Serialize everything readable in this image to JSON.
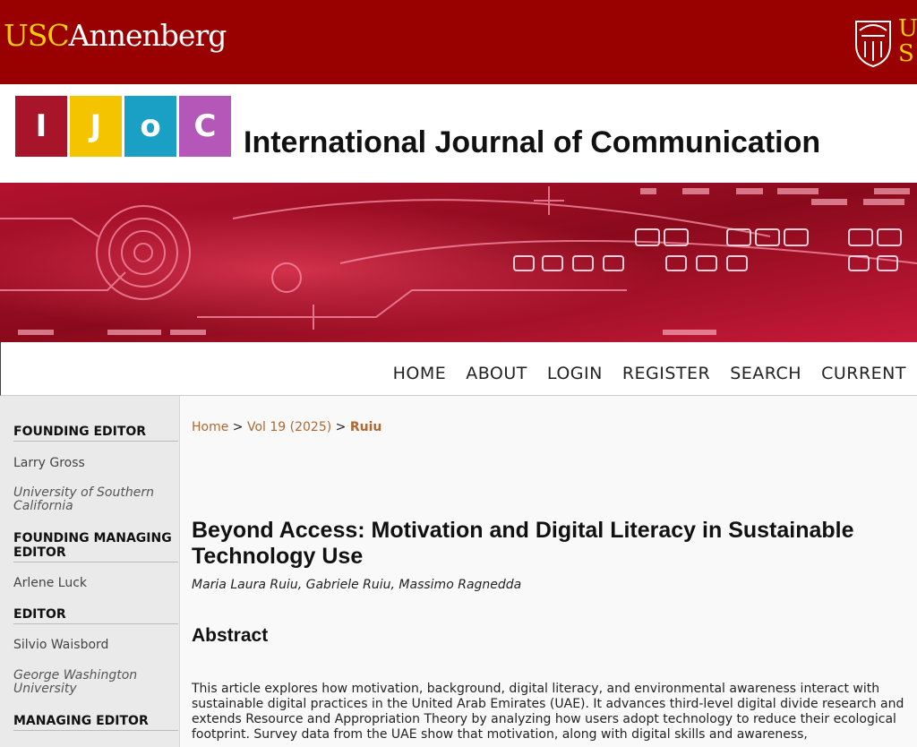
{
  "usc": {
    "logo_usc": "USC",
    "logo_annenberg": "Annenberg",
    "right_text": "U\nS"
  },
  "journal": {
    "tiles": [
      "I",
      "J",
      "o",
      "C"
    ],
    "title": "International Journal of Communication"
  },
  "nav": {
    "items": [
      "HOME",
      "ABOUT",
      "LOGIN",
      "REGISTER",
      "SEARCH",
      "CURRENT"
    ]
  },
  "sidebar": {
    "founding_editor_heading": "FOUNDING EDITOR",
    "founding_editor_name": "Larry Gross",
    "founding_editor_affil": "University of Southern California",
    "founding_managing_heading": "FOUNDING MANAGING EDITOR",
    "founding_managing_name": "Arlene Luck",
    "editor_heading": "EDITOR",
    "editor_name": "Silvio Waisbord",
    "editor_affil": "George Washington University",
    "managing_heading": "MANAGING EDITOR"
  },
  "breadcrumb": {
    "home": "Home",
    "sep1": ">",
    "volume": "Vol 19 (2025)",
    "sep2": ">",
    "current": "Ruiu"
  },
  "article": {
    "title": "Beyond Access: Motivation and Digital Literacy in Sustainable Technology Use",
    "authors": "Maria Laura Ruiu, Gabriele Ruiu, Massimo Ragnedda",
    "abstract_heading": "Abstract",
    "abstract_text": "This article explores how motivation, background, digital literacy, and environmental awareness interact with sustainable digital practices in the United Arab Emirates (UAE). It advances third-level digital divide research and extends Resource and Appropriation Theory by analyzing how users adopt technology to reduce their ecological footprint. Survey data from the UAE show that motivation, along with digital skills and awareness,"
  },
  "colors": {
    "usc_red": "#990000",
    "usc_gold": "#ffcc00",
    "link_brown": "#b06830"
  }
}
